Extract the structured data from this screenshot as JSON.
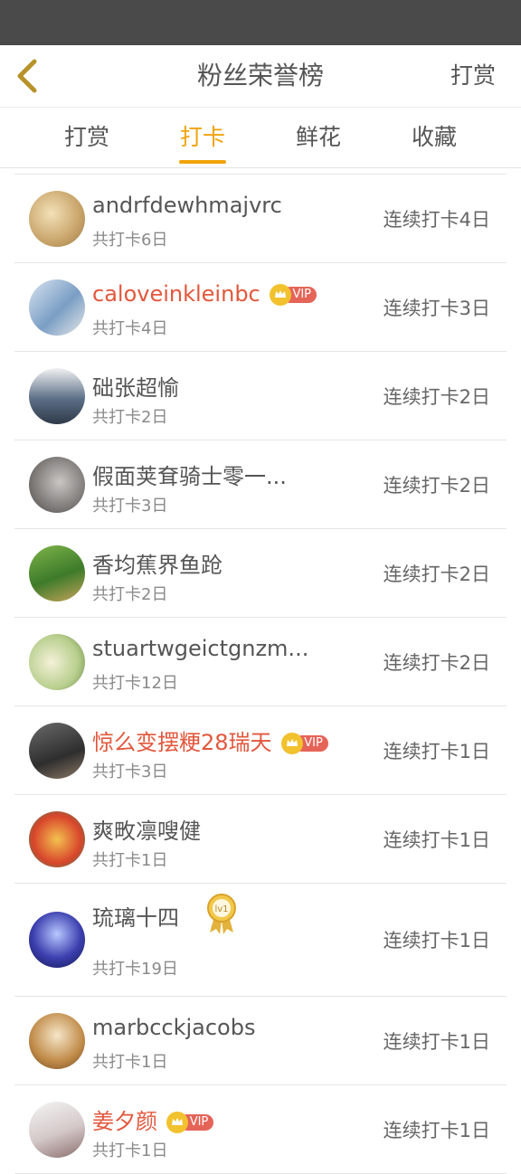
{
  "header": {
    "title": "粉丝荣誉榜",
    "right_action": "打赏"
  },
  "tabs": [
    {
      "label": "打赏",
      "active": false
    },
    {
      "label": "打卡",
      "active": true
    },
    {
      "label": "鲜花",
      "active": false
    },
    {
      "label": "收藏",
      "active": false
    }
  ],
  "vip_label": "VIP",
  "medal_label": "lv1",
  "colors": {
    "accent": "#f0a30a",
    "vip_name": "#e2573c",
    "vip_badge": "#e56458",
    "crown": "#f2c12e"
  },
  "list": [
    {
      "name": "andrfdewhmajvrc",
      "total": "共打卡6日",
      "streak": "连续打卡4日",
      "vip": false
    },
    {
      "name": "caloveinkleinbc",
      "total": "共打卡4日",
      "streak": "连续打卡3日",
      "vip": true
    },
    {
      "name": "础张超愉",
      "total": "共打卡2日",
      "streak": "连续打卡2日",
      "vip": false
    },
    {
      "name": "假面荚耷骑士零一...",
      "total": "共打卡3日",
      "streak": "连续打卡2日",
      "vip": false
    },
    {
      "name": "香均蕉界鱼跄",
      "total": "共打卡2日",
      "streak": "连续打卡2日",
      "vip": false
    },
    {
      "name": "stuartwgeictgnzm...",
      "total": "共打卡12日",
      "streak": "连续打卡2日",
      "vip": false
    },
    {
      "name": "惊么变摆粳28瑞天",
      "total": "共打卡3日",
      "streak": "连续打卡1日",
      "vip": true
    },
    {
      "name": "爽畋凛嗖健",
      "total": "共打卡1日",
      "streak": "连续打卡1日",
      "vip": false
    },
    {
      "name": "琉璃十四",
      "total": "共打卡19日",
      "streak": "连续打卡1日",
      "vip": false,
      "medal": true
    },
    {
      "name": "marbcckjacobs",
      "total": "共打卡1日",
      "streak": "连续打卡1日",
      "vip": false
    },
    {
      "name": "姜夕颜",
      "total": "共打卡1日",
      "streak": "连续打卡1日",
      "vip": true
    }
  ]
}
